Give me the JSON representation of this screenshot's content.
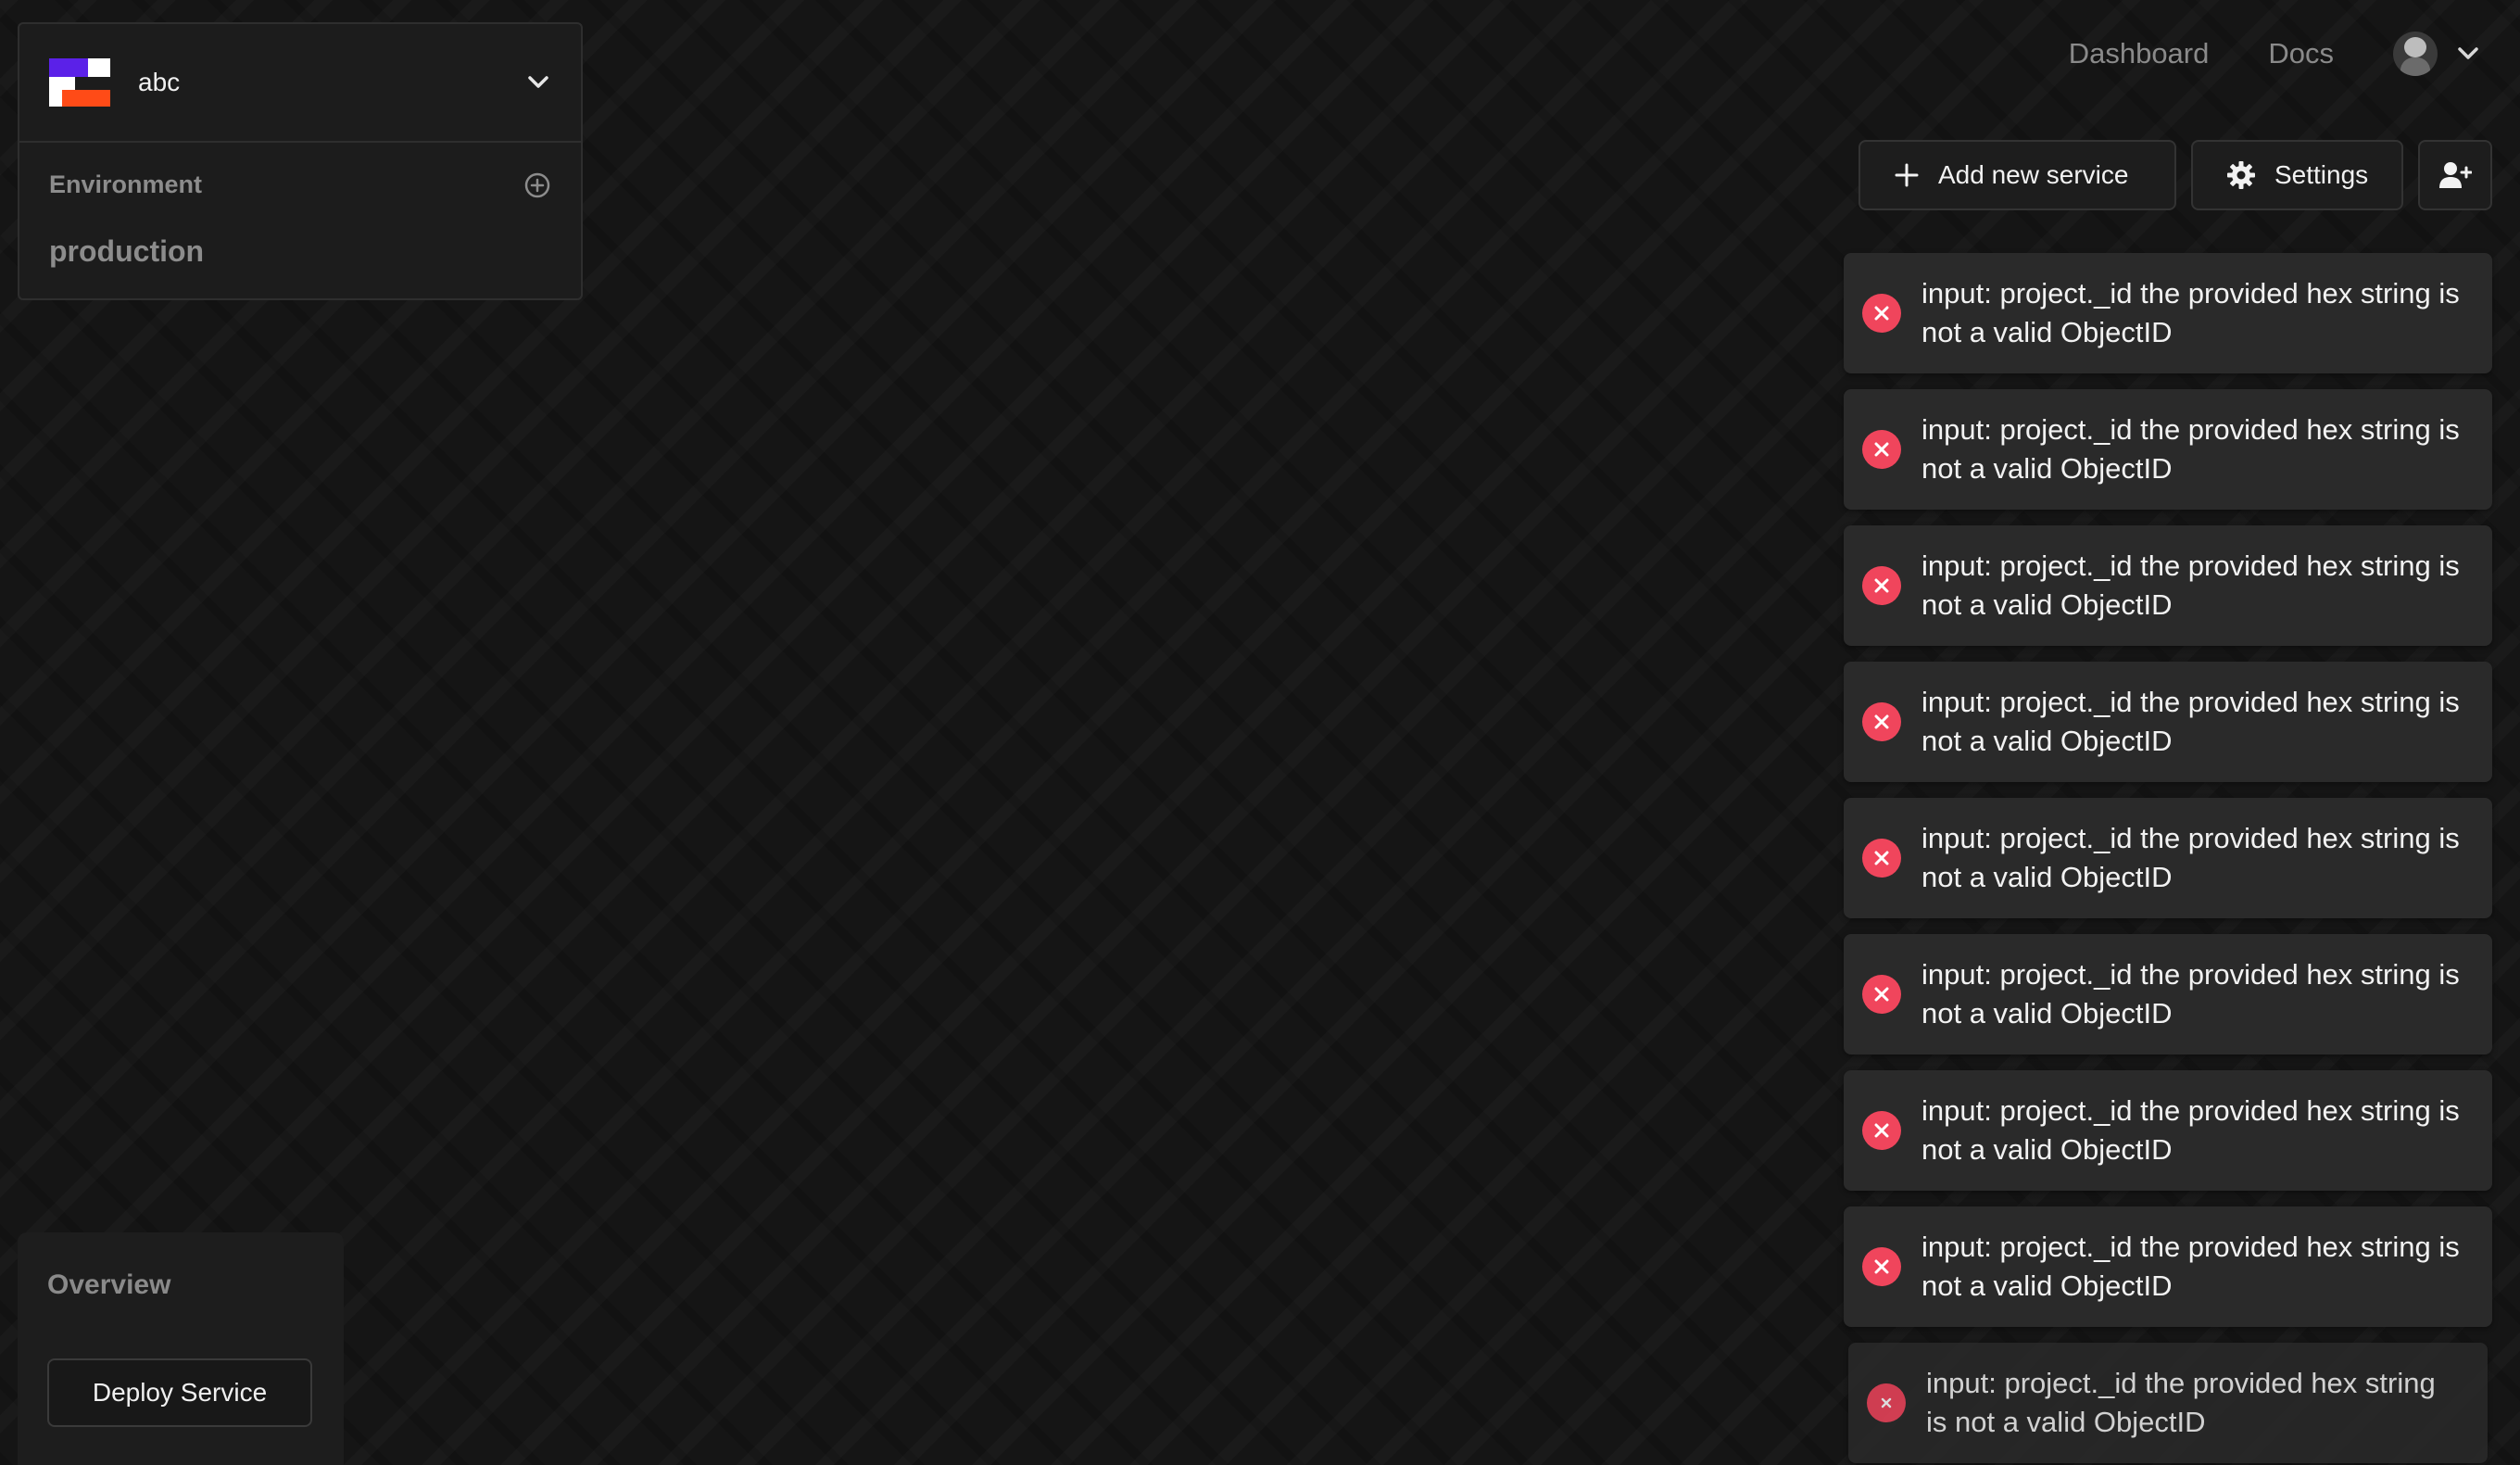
{
  "project": {
    "name": "abc",
    "environment_label": "Environment",
    "environment_value": "production"
  },
  "nav": {
    "dashboard": "Dashboard",
    "docs": "Docs"
  },
  "actions": {
    "add_service": "Add new service",
    "settings": "Settings"
  },
  "toasts": [
    "input: project._id the provided hex string is not a valid ObjectID",
    "input: project._id the provided hex string is not a valid ObjectID",
    "input: project._id the provided hex string is not a valid ObjectID",
    "input: project._id the provided hex string is not a valid ObjectID",
    "input: project._id the provided hex string is not a valid ObjectID",
    "input: project._id the provided hex string is not a valid ObjectID",
    "input: project._id the provided hex string is not a valid ObjectID",
    "input: project._id the provided hex string is not a valid ObjectID",
    "input: project._id the provided hex string is not a valid ObjectID"
  ],
  "overview": {
    "title": "Overview",
    "deploy_button": "Deploy Service"
  },
  "colors": {
    "background": "#151515",
    "panel": "#1c1c1c",
    "toast": "#2a2a2a",
    "error": "#f0455c",
    "logo_purple": "#5b21e8",
    "logo_orange": "#ff4b17"
  },
  "icons": [
    "chevron-down-icon",
    "plus-circle-icon",
    "plus-icon",
    "gear-icon",
    "add-user-icon",
    "error-icon",
    "avatar"
  ]
}
